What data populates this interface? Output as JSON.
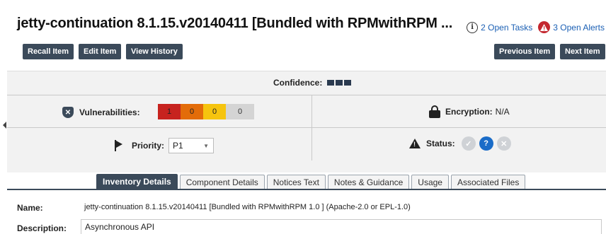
{
  "header": {
    "title": "jetty-continuation 8.1.15.v20140411 [Bundled with RPMwithRPM ...",
    "open_tasks": "2 Open Tasks",
    "open_alerts": "3 Open Alerts"
  },
  "toolbar": {
    "recall": "Recall Item",
    "edit": "Edit Item",
    "history": "View History",
    "previous": "Previous Item",
    "next": "Next Item"
  },
  "summary": {
    "confidence_label": "Confidence:",
    "vulnerabilities_label": "Vulnerabilities:",
    "vuln_counts": [
      "1",
      "0",
      "0",
      "0"
    ],
    "encryption_label": "Encryption:",
    "encryption_value": "N/A",
    "priority_label": "Priority:",
    "priority_value": "P1",
    "status_label": "Status:",
    "status_question": "?"
  },
  "tabs": [
    {
      "label": "Inventory Details",
      "active": true
    },
    {
      "label": "Component Details"
    },
    {
      "label": "Notices Text"
    },
    {
      "label": "Notes & Guidance"
    },
    {
      "label": "Usage"
    },
    {
      "label": "Associated Files"
    }
  ],
  "details": {
    "name_label": "Name:",
    "name_value": "jetty-continuation 8.1.15.v20140411 [Bundled with RPMwithRPM 1.0 ] (Apache-2.0 or EPL-1.0)",
    "description_label": "Description:",
    "description_value": "Asynchronous API"
  },
  "colors": {
    "dark_button": "#3b4a5a",
    "critical": "#c7231f",
    "high": "#e36c09",
    "medium": "#f6c40e",
    "low": "#d4d4d4",
    "accent_blue": "#1a6cc8",
    "alert_red": "#c4262e"
  }
}
